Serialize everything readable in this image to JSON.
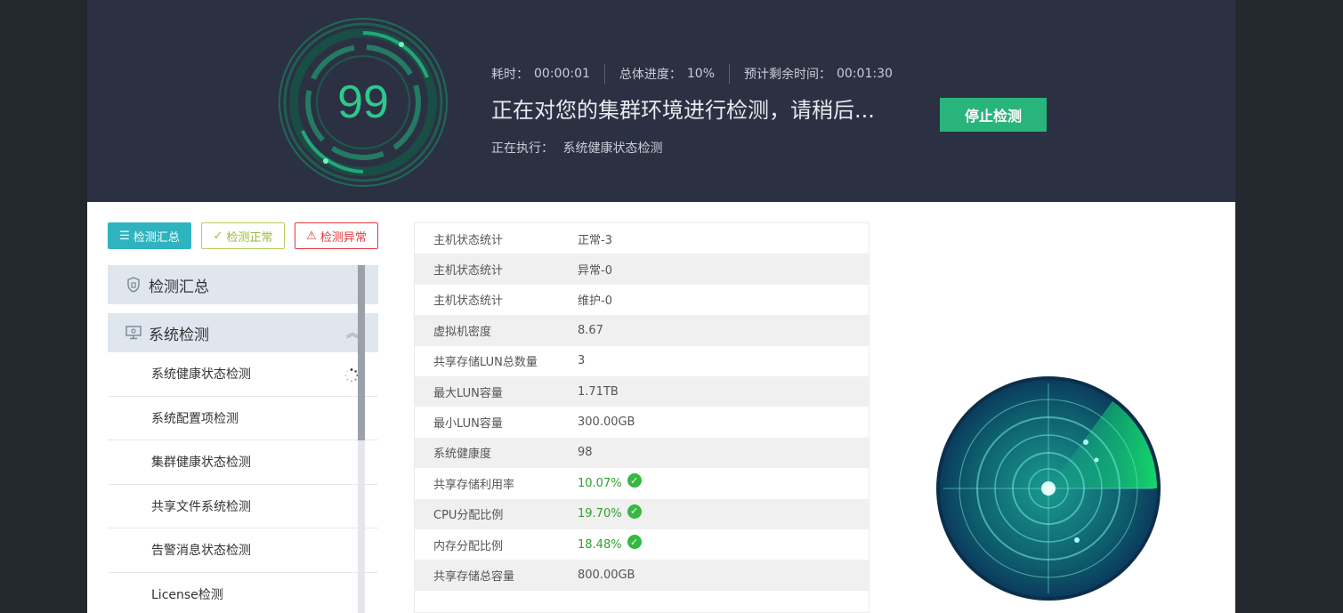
{
  "header": {
    "score": "99",
    "elapsed_label": "耗时：",
    "elapsed_value": "00:00:01",
    "progress_label": "总体进度：",
    "progress_value": "10%",
    "remaining_label": "预计剩余时间：",
    "remaining_value": "00:01:30",
    "title": "正在对您的集群环境进行检测，请稍后...",
    "running_label": "正在执行：",
    "running_value": "系统健康状态检测",
    "stop_button": "停止检测"
  },
  "filters": [
    {
      "label": "检测汇总",
      "icon": "list-icon"
    },
    {
      "label": "检测正常",
      "icon": "check-circle-icon"
    },
    {
      "label": "检测异常",
      "icon": "alert-bell-icon"
    }
  ],
  "nav": {
    "summary": "检测汇总",
    "system": "系统检测",
    "items": [
      "系统健康状态检测",
      "系统配置项检测",
      "集群健康状态检测",
      "共享文件系统检测",
      "告警消息状态检测",
      "License检测"
    ]
  },
  "table": [
    {
      "label": "主机状态统计",
      "value": "正常-3",
      "ok": false
    },
    {
      "label": "主机状态统计",
      "value": "异常-0",
      "ok": false
    },
    {
      "label": "主机状态统计",
      "value": "维护-0",
      "ok": false
    },
    {
      "label": "虚拟机密度",
      "value": "8.67",
      "ok": false
    },
    {
      "label": "共享存储LUN总数量",
      "value": "3",
      "ok": false
    },
    {
      "label": "最大LUN容量",
      "value": "1.71TB",
      "ok": false
    },
    {
      "label": "最小LUN容量",
      "value": "300.00GB",
      "ok": false
    },
    {
      "label": "系统健康度",
      "value": "98",
      "ok": false
    },
    {
      "label": "共享存储利用率",
      "value": "10.07%",
      "ok": true
    },
    {
      "label": "CPU分配比例",
      "value": "19.70%",
      "ok": true
    },
    {
      "label": "内存分配比例",
      "value": "18.48%",
      "ok": true
    },
    {
      "label": "共享存储总容量",
      "value": "800.00GB",
      "ok": false
    }
  ],
  "colors": {
    "header_bg": "#2b3143",
    "accent_green": "#29b47c",
    "filter_summary": "#2fb3bf",
    "filter_normal": "#9bbb3a",
    "filter_abnormal": "#e2393d"
  }
}
